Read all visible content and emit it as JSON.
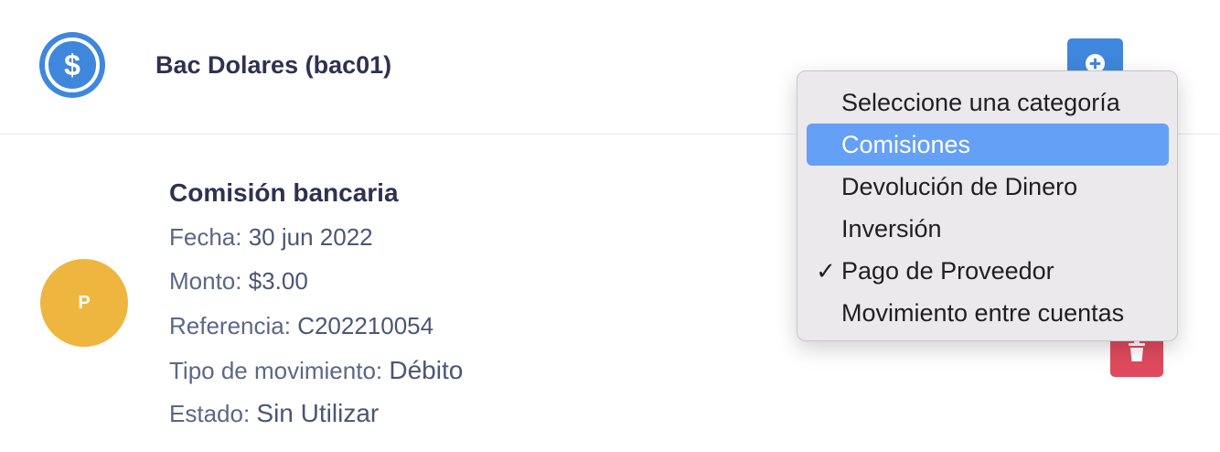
{
  "account": {
    "title": "Bac Dolares (bac01)",
    "icon": "dollar-circle-icon",
    "icon_color": "#3f87dc"
  },
  "actions": {
    "add_icon": "plus-circle-icon",
    "add_color": "#3f87dc",
    "delete_icon": "trash-icon",
    "delete_color": "#e04a5e"
  },
  "transaction": {
    "avatar_letter": "P",
    "avatar_color": "#efb63f",
    "title": "Comisión bancaria",
    "fecha_label": "Fecha: ",
    "fecha_value": "30 jun 2022",
    "monto_label": "Monto: ",
    "monto_value": "$3.00",
    "referencia_label": "Referencia: ",
    "referencia_value": "C202210054",
    "tipo_label": "Tipo de movimiento: ",
    "tipo_value": "Débito",
    "estado_label": "Estado: ",
    "estado_value": "Sin Utilizar"
  },
  "category_dropdown": {
    "options": [
      {
        "label": "Seleccione una categoría",
        "checked": "",
        "highlighted": false
      },
      {
        "label": "Comisiones",
        "checked": "",
        "highlighted": true
      },
      {
        "label": "Devolución de Dinero",
        "checked": "",
        "highlighted": false
      },
      {
        "label": "Inversión",
        "checked": "",
        "highlighted": false
      },
      {
        "label": "Pago de Proveedor",
        "checked": "✓",
        "highlighted": false
      },
      {
        "label": "Movimiento entre cuentas",
        "checked": "",
        "highlighted": false
      }
    ],
    "highlight_color": "#64a0f6"
  }
}
